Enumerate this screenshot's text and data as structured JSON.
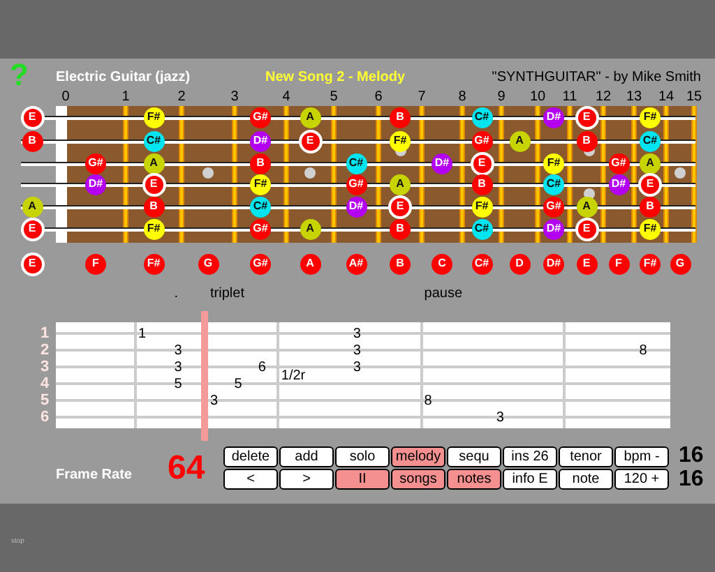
{
  "help": "?",
  "header": {
    "instrument": "Electric Guitar (jazz)",
    "song": "New Song 2 - Melody",
    "credit": "\"SYNTHGUITAR\" - by Mike Smith"
  },
  "fret_numbers": [
    "0",
    "1",
    "2",
    "3",
    "4",
    "5",
    "6",
    "7",
    "8",
    "9",
    "10",
    "11",
    "12",
    "13",
    "14",
    "15"
  ],
  "strings": [
    {
      "slots": [
        {
          "kind": "note",
          "name": "E",
          "color": "#ff0000",
          "root": true
        },
        {
          "kind": "empty"
        },
        {
          "kind": "note",
          "name": "F#",
          "color": "#ffff00",
          "root": false
        },
        {
          "kind": "empty"
        },
        {
          "kind": "note",
          "name": "G#",
          "color": "#ff0000",
          "root": false
        },
        {
          "kind": "note",
          "name": "A",
          "color": "#c8d400",
          "root": false
        },
        {
          "kind": "empty"
        },
        {
          "kind": "note",
          "name": "B",
          "color": "#ff0000",
          "root": false
        },
        {
          "kind": "empty"
        },
        {
          "kind": "note",
          "name": "C#",
          "color": "#00e5f0",
          "root": false
        },
        {
          "kind": "empty"
        },
        {
          "kind": "note",
          "name": "D#",
          "color": "#b400f0",
          "root": false
        },
        {
          "kind": "note",
          "name": "E",
          "color": "#ff0000",
          "root": true
        },
        {
          "kind": "empty"
        },
        {
          "kind": "note",
          "name": "F#",
          "color": "#ffff00",
          "root": false
        },
        {
          "kind": "empty"
        }
      ]
    },
    {
      "slots": [
        {
          "kind": "note",
          "name": "B",
          "color": "#ff0000",
          "root": false
        },
        {
          "kind": "empty"
        },
        {
          "kind": "note",
          "name": "C#",
          "color": "#00e5f0",
          "root": false
        },
        {
          "kind": "empty"
        },
        {
          "kind": "note",
          "name": "D#",
          "color": "#b400f0",
          "root": false
        },
        {
          "kind": "note",
          "name": "E",
          "color": "#ff0000",
          "root": true
        },
        {
          "kind": "empty"
        },
        {
          "kind": "note",
          "name": "F#",
          "color": "#ffff00",
          "root": false
        },
        {
          "kind": "empty"
        },
        {
          "kind": "note",
          "name": "G#",
          "color": "#ff0000",
          "root": false
        },
        {
          "kind": "note",
          "name": "A",
          "color": "#c8d400",
          "root": false
        },
        {
          "kind": "empty"
        },
        {
          "kind": "note",
          "name": "B",
          "color": "#ff0000",
          "root": false
        },
        {
          "kind": "empty"
        },
        {
          "kind": "note",
          "name": "C#",
          "color": "#00e5f0",
          "root": false
        },
        {
          "kind": "empty"
        }
      ]
    },
    {
      "slots": [
        {
          "kind": "empty"
        },
        {
          "kind": "note",
          "name": "G#",
          "color": "#ff0000",
          "root": false
        },
        {
          "kind": "note",
          "name": "A",
          "color": "#c8d400",
          "root": false
        },
        {
          "kind": "empty"
        },
        {
          "kind": "note",
          "name": "B",
          "color": "#ff0000",
          "root": false
        },
        {
          "kind": "empty"
        },
        {
          "kind": "note",
          "name": "C#",
          "color": "#00e5f0",
          "root": false
        },
        {
          "kind": "empty"
        },
        {
          "kind": "note",
          "name": "D#",
          "color": "#b400f0",
          "root": false
        },
        {
          "kind": "note",
          "name": "E",
          "color": "#ff0000",
          "root": true
        },
        {
          "kind": "empty"
        },
        {
          "kind": "note",
          "name": "F#",
          "color": "#ffff00",
          "root": false
        },
        {
          "kind": "empty"
        },
        {
          "kind": "note",
          "name": "G#",
          "color": "#ff0000",
          "root": false
        },
        {
          "kind": "note",
          "name": "A",
          "color": "#c8d400",
          "root": false
        },
        {
          "kind": "empty"
        }
      ]
    },
    {
      "slots": [
        {
          "kind": "empty"
        },
        {
          "kind": "note",
          "name": "D#",
          "color": "#b400f0",
          "root": false
        },
        {
          "kind": "note",
          "name": "E",
          "color": "#ff0000",
          "root": true
        },
        {
          "kind": "empty"
        },
        {
          "kind": "note",
          "name": "F#",
          "color": "#ffff00",
          "root": false
        },
        {
          "kind": "empty"
        },
        {
          "kind": "note",
          "name": "G#",
          "color": "#ff0000",
          "root": false
        },
        {
          "kind": "note",
          "name": "A",
          "color": "#c8d400",
          "root": false
        },
        {
          "kind": "empty"
        },
        {
          "kind": "note",
          "name": "B",
          "color": "#ff0000",
          "root": false
        },
        {
          "kind": "empty"
        },
        {
          "kind": "note",
          "name": "C#",
          "color": "#00e5f0",
          "root": false
        },
        {
          "kind": "empty"
        },
        {
          "kind": "note",
          "name": "D#",
          "color": "#b400f0",
          "root": false
        },
        {
          "kind": "note",
          "name": "E",
          "color": "#ff0000",
          "root": true
        },
        {
          "kind": "empty"
        }
      ]
    },
    {
      "slots": [
        {
          "kind": "note",
          "name": "A",
          "color": "#c8d400",
          "root": false
        },
        {
          "kind": "empty"
        },
        {
          "kind": "note",
          "name": "B",
          "color": "#ff0000",
          "root": false
        },
        {
          "kind": "empty"
        },
        {
          "kind": "note",
          "name": "C#",
          "color": "#00e5f0",
          "root": false
        },
        {
          "kind": "empty"
        },
        {
          "kind": "note",
          "name": "D#",
          "color": "#b400f0",
          "root": false
        },
        {
          "kind": "note",
          "name": "E",
          "color": "#ff0000",
          "root": true
        },
        {
          "kind": "empty"
        },
        {
          "kind": "note",
          "name": "F#",
          "color": "#ffff00",
          "root": false
        },
        {
          "kind": "empty"
        },
        {
          "kind": "note",
          "name": "G#",
          "color": "#ff0000",
          "root": false
        },
        {
          "kind": "note",
          "name": "A",
          "color": "#c8d400",
          "root": false
        },
        {
          "kind": "empty"
        },
        {
          "kind": "note",
          "name": "B",
          "color": "#ff0000",
          "root": false
        },
        {
          "kind": "empty"
        }
      ]
    },
    {
      "slots": [
        {
          "kind": "note",
          "name": "E",
          "color": "#ff0000",
          "root": true
        },
        {
          "kind": "empty"
        },
        {
          "kind": "note",
          "name": "F#",
          "color": "#ffff00",
          "root": false
        },
        {
          "kind": "empty"
        },
        {
          "kind": "note",
          "name": "G#",
          "color": "#ff0000",
          "root": false
        },
        {
          "kind": "note",
          "name": "A",
          "color": "#c8d400",
          "root": false
        },
        {
          "kind": "empty"
        },
        {
          "kind": "note",
          "name": "B",
          "color": "#ff0000",
          "root": false
        },
        {
          "kind": "empty"
        },
        {
          "kind": "note",
          "name": "C#",
          "color": "#00e5f0",
          "root": false
        },
        {
          "kind": "empty"
        },
        {
          "kind": "note",
          "name": "D#",
          "color": "#b400f0",
          "root": false
        },
        {
          "kind": "note",
          "name": "E",
          "color": "#ff0000",
          "root": true
        },
        {
          "kind": "empty"
        },
        {
          "kind": "note",
          "name": "F#",
          "color": "#ffff00",
          "root": false
        },
        {
          "kind": "empty"
        }
      ]
    }
  ],
  "note_row": [
    {
      "name": "E",
      "root": true
    },
    {
      "name": "F",
      "root": false
    },
    {
      "name": "F#",
      "root": false
    },
    {
      "name": "G",
      "root": false
    },
    {
      "name": "G#",
      "root": false
    },
    {
      "name": "A",
      "root": false
    },
    {
      "name": "A#",
      "root": false
    },
    {
      "name": "B",
      "root": false
    },
    {
      "name": "C",
      "root": false
    },
    {
      "name": "C#",
      "root": false
    },
    {
      "name": "D",
      "root": false
    },
    {
      "name": "D#",
      "root": false
    },
    {
      "name": "E",
      "root": false
    },
    {
      "name": "F",
      "root": false
    },
    {
      "name": "F#",
      "root": false
    },
    {
      "name": "G",
      "root": false
    }
  ],
  "tab": {
    "string_labels": [
      "1",
      "2",
      "3",
      "4",
      "5",
      "6"
    ],
    "playhead": {
      "level": 0.24
    },
    "bars": [
      {
        "steps": [
          {
            "kind": "chord",
            "frets": {
              "s1": "1"
            }
          },
          {
            "kind": "empty"
          },
          {
            "kind": "empty"
          },
          {
            "kind": "empty"
          },
          {
            "kind": "chord",
            "mark": ".",
            "frets": {
              "s2": "3",
              "s3": "3",
              "s4": "5"
            }
          },
          {
            "kind": "empty"
          },
          {
            "kind": "empty"
          },
          {
            "kind": "empty"
          },
          {
            "kind": "triplet",
            "mark": "triplet",
            "chords": [
              {
                "s5": "3"
              },
              {
                "s4": "5"
              },
              {
                "s3": "6"
              }
            ]
          },
          {
            "kind": "empty"
          },
          {
            "kind": "empty"
          },
          {
            "kind": "empty"
          },
          {
            "kind": "empty"
          },
          {
            "kind": "empty"
          },
          {
            "kind": "empty"
          },
          {
            "kind": "empty"
          }
        ]
      },
      {
        "steps": [
          {
            "kind": "rest",
            "text": "1/2r"
          },
          {
            "kind": "empty"
          },
          {
            "kind": "empty"
          },
          {
            "kind": "empty"
          },
          {
            "kind": "empty"
          },
          {
            "kind": "empty"
          },
          {
            "kind": "empty"
          },
          {
            "kind": "empty"
          },
          {
            "kind": "chord",
            "frets": {
              "s1": "3",
              "s2": "3",
              "s3": "3"
            }
          },
          {
            "kind": "empty"
          },
          {
            "kind": "empty"
          },
          {
            "kind": "empty"
          },
          {
            "kind": "empty"
          },
          {
            "kind": "empty"
          },
          {
            "kind": "empty"
          },
          {
            "kind": "empty"
          }
        ]
      },
      {
        "steps": [
          {
            "kind": "chord",
            "mark": "pause",
            "frets": {
              "s5": "8"
            }
          },
          {
            "kind": "empty"
          },
          {
            "kind": "empty"
          },
          {
            "kind": "empty"
          },
          {
            "kind": "empty"
          },
          {
            "kind": "empty"
          },
          {
            "kind": "empty"
          },
          {
            "kind": "empty"
          },
          {
            "kind": "chord",
            "frets": {
              "s6": "3"
            }
          },
          {
            "kind": "empty"
          },
          {
            "kind": "empty"
          },
          {
            "kind": "empty"
          },
          {
            "kind": "empty"
          },
          {
            "kind": "empty"
          },
          {
            "kind": "empty"
          },
          {
            "kind": "empty"
          }
        ]
      },
      {
        "steps": [
          {
            "kind": "empty"
          },
          {
            "kind": "empty"
          },
          {
            "kind": "empty"
          },
          {
            "kind": "empty"
          },
          {
            "kind": "empty"
          },
          {
            "kind": "empty"
          },
          {
            "kind": "empty"
          },
          {
            "kind": "empty"
          },
          {
            "kind": "chord",
            "frets": {
              "s2": "8"
            }
          },
          {
            "kind": "empty"
          },
          {
            "kind": "empty"
          },
          {
            "kind": "empty"
          },
          {
            "kind": "empty"
          },
          {
            "kind": "empty"
          },
          {
            "kind": "empty"
          },
          {
            "kind": "empty"
          }
        ]
      }
    ]
  },
  "frame_rate": {
    "label": "Frame Rate",
    "value": "64"
  },
  "buttons": [
    [
      {
        "label": "delete",
        "on": false
      },
      {
        "label": "add",
        "on": false
      },
      {
        "label": "solo",
        "on": false
      },
      {
        "label": "melody",
        "on": true
      },
      {
        "label": "sequ",
        "on": false
      },
      {
        "label": "ins 26",
        "on": false
      },
      {
        "label": "tenor",
        "on": false
      },
      {
        "label": "bpm -",
        "on": false
      }
    ],
    [
      {
        "label": "<",
        "on": false
      },
      {
        "label": ">",
        "on": false
      },
      {
        "label": "II",
        "on": true
      },
      {
        "label": "songs",
        "on": true
      },
      {
        "label": "notes",
        "on": true
      },
      {
        "label": "info E",
        "on": false
      },
      {
        "label": "note",
        "on": false
      },
      {
        "label": "120 +",
        "on": false
      }
    ]
  ],
  "counters": [
    "16",
    "16"
  ],
  "status": "stop"
}
